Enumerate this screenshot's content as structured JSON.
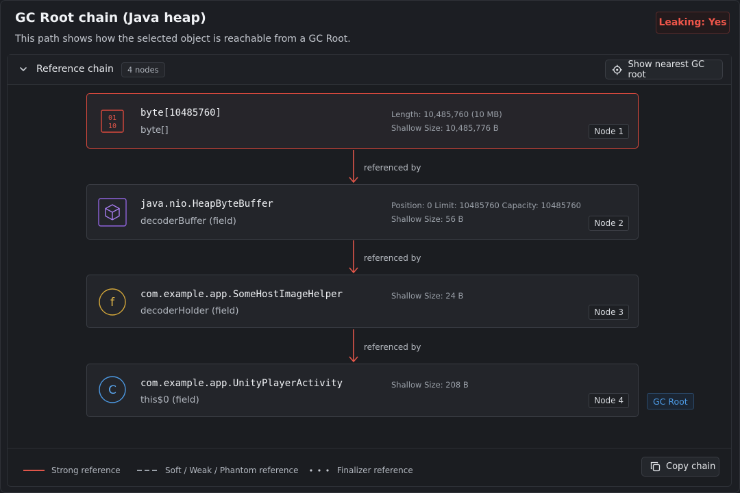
{
  "header": {
    "title": "GC Root chain (Java heap)",
    "subtitle": "This path shows how the selected object is reachable from a GC Root.",
    "leaking_label": "Leaking: Yes"
  },
  "panel": {
    "title": "Reference chain",
    "node_count": "4 nodes",
    "nearest_button": "Show nearest GC root"
  },
  "nodes": [
    {
      "name": "byte[10485760]",
      "sub": "byte[]",
      "meta1": "Length: 10,485,760 (10 MB)",
      "meta2": "Shallow Size: 10,485,776 B",
      "tag": "Node 1",
      "icon_text_top": "01",
      "icon_text_bottom": "10",
      "icon": "binary-icon"
    },
    {
      "name": "java.nio.HeapByteBuffer",
      "sub": "decoderBuffer (field)",
      "meta1": "Position: 0   Limit: 10485760   Capacity: 10485760",
      "meta2": "Shallow Size: 56 B",
      "tag": "Node 2",
      "icon": "cube-icon"
    },
    {
      "name": "com.example.app.SomeHostImageHelper",
      "sub": "decoderHolder (field)",
      "meta1": "Shallow Size: 24 B",
      "tag": "Node 3",
      "icon_text": "f",
      "icon": "field-icon"
    },
    {
      "name": "com.example.app.UnityPlayerActivity",
      "sub": "this$0 (field)",
      "meta1": "Shallow Size: 208 B",
      "tag": "Node 4",
      "icon_text": "C",
      "icon": "class-icon"
    }
  ],
  "arrows": [
    {
      "label": "referenced by"
    },
    {
      "label": "referenced by"
    },
    {
      "label": "referenced by"
    }
  ],
  "gc_root_label": "GC Root",
  "legend": {
    "strong": "Strong reference",
    "soft": "Soft / Weak / Phantom reference",
    "finalizer": "Finalizer reference"
  },
  "copy_button": "Copy chain",
  "colors": {
    "accent_red": "#d9493d",
    "purple": "#9b6ee8",
    "yellow": "#d6a93a",
    "blue": "#4d9be6"
  }
}
